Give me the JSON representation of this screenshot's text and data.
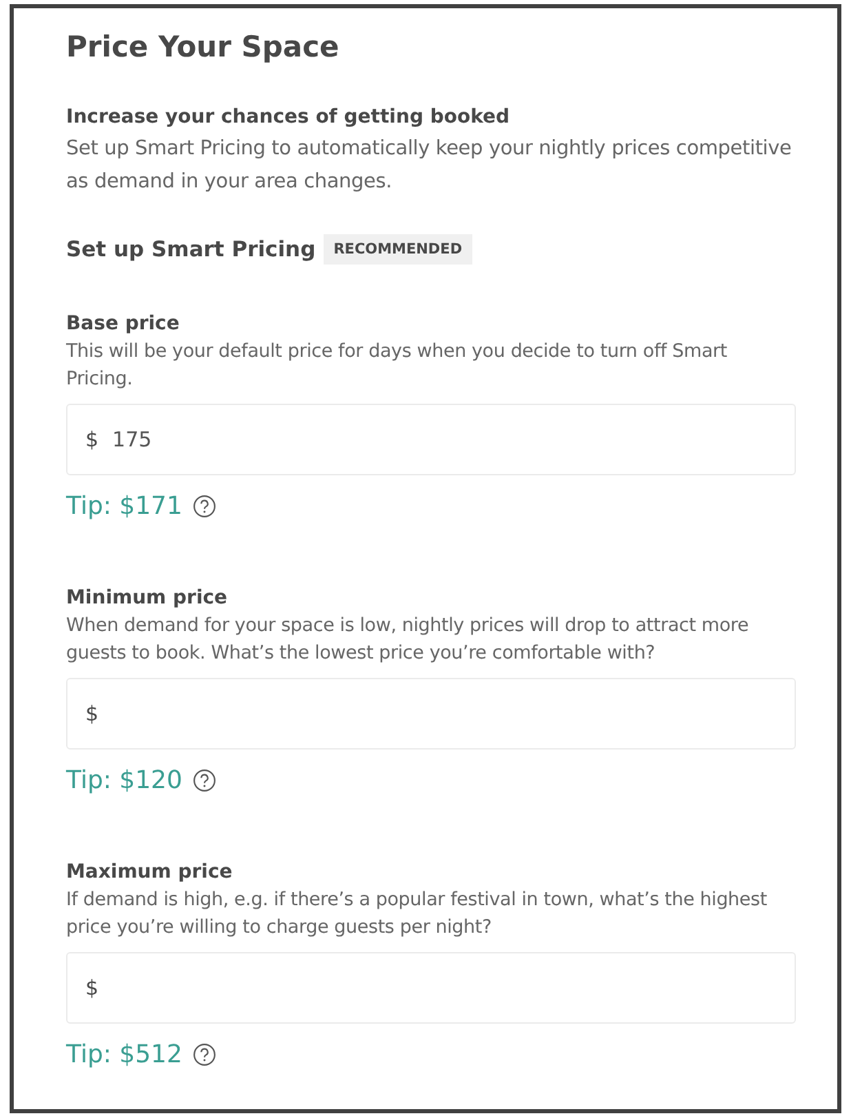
{
  "title": "Price Your Space",
  "intro": {
    "heading": "Increase your chances of getting booked",
    "text": "Set up Smart Pricing to automatically keep your nightly prices competitive as demand in your area changes."
  },
  "section": {
    "heading": "Set up Smart Pricing",
    "badge": "RECOMMENDED"
  },
  "fields": [
    {
      "label": "Base price",
      "description": "This will be your default price for days when you decide to turn off Smart Pricing.",
      "prefix": "$",
      "value": "175",
      "tip": "Tip: $171"
    },
    {
      "label": "Minimum price",
      "description": "When demand for your space is low, nightly prices will drop to attract more guests to book. What’s the lowest price you’re comfortable with?",
      "prefix": "$",
      "tip": "Tip: $120"
    },
    {
      "label": "Maximum price",
      "description": "If demand is high, e.g. if there’s a popular festival in town, what’s the highest price you’re willing to charge guests per night?",
      "prefix": "$",
      "tip": "Tip: $512"
    }
  ]
}
